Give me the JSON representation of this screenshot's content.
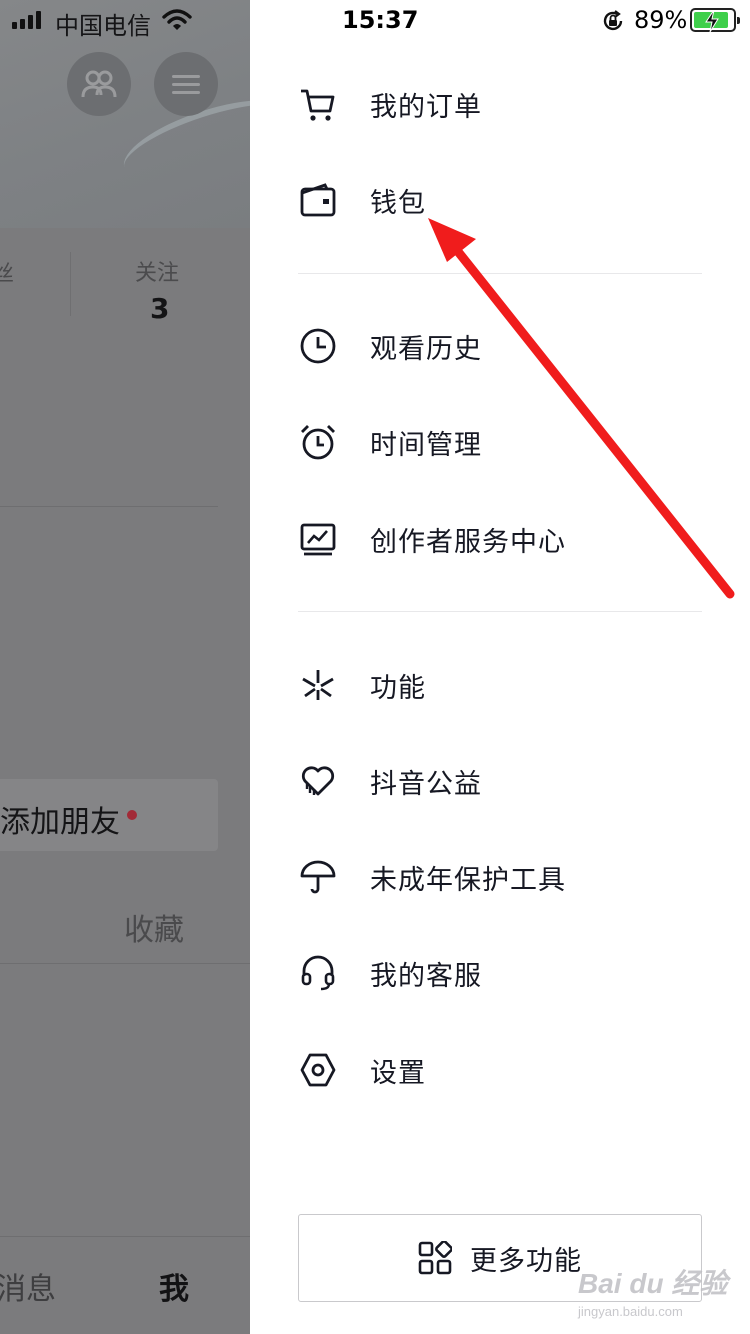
{
  "status_bar": {
    "carrier": "中国电信",
    "time": "15:37",
    "battery_percent": "89%",
    "battery_level": 0.89,
    "charging": true
  },
  "background_profile": {
    "stat_label_cut": "丝",
    "follow_label": "关注",
    "follow_count": "3",
    "add_friend_label": "添加朋友",
    "collect_tab": "收藏",
    "bottom_tab_messages": "消息",
    "bottom_tab_me": "我"
  },
  "drawer": {
    "group1": [
      {
        "label": "我的订单",
        "icon": "cart-icon"
      },
      {
        "label": "钱包",
        "icon": "wallet-icon"
      }
    ],
    "group2": [
      {
        "label": "观看历史",
        "icon": "clock-icon"
      },
      {
        "label": "时间管理",
        "icon": "alarm-clock-icon"
      },
      {
        "label": "创作者服务中心",
        "icon": "monitor-chart-icon"
      }
    ],
    "group3": [
      {
        "label": "功能",
        "icon": "sparkle-icon"
      },
      {
        "label": "抖音公益",
        "icon": "heart-hands-icon"
      },
      {
        "label": "未成年保护工具",
        "icon": "umbrella-icon"
      },
      {
        "label": "我的客服",
        "icon": "headset-icon"
      },
      {
        "label": "设置",
        "icon": "settings-hex-icon"
      }
    ],
    "more_button": {
      "label": "更多功能",
      "icon": "grid-apps-icon"
    }
  },
  "annotation": {
    "arrow_color": "#f01c1c",
    "target": "钱包"
  },
  "watermark": {
    "main": "Bai du 经验",
    "sub": "jingyan.baidu.com"
  },
  "colors": {
    "text": "#161823",
    "divider": "#e8e8ea",
    "overlay": "#7b7b7d",
    "battery": "#3fcf4b"
  }
}
